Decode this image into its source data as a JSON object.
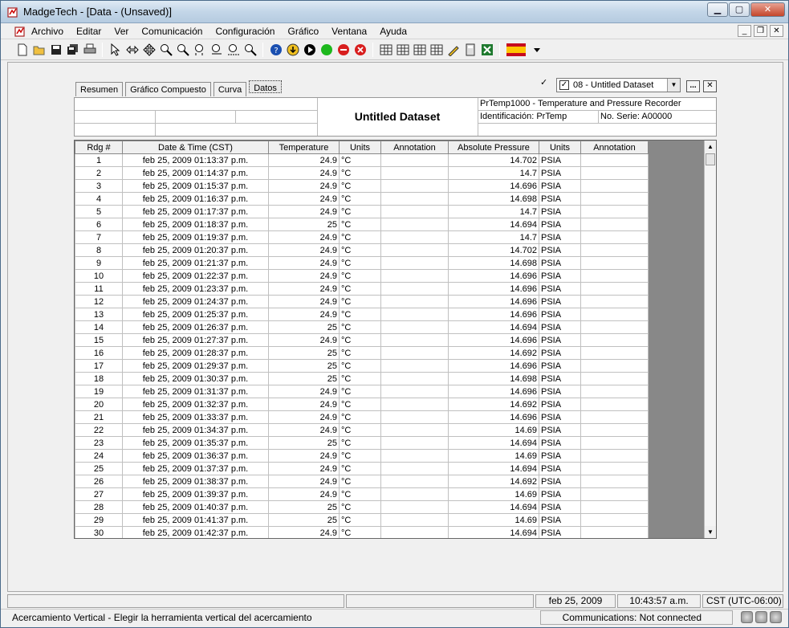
{
  "window": {
    "title": "MadgeTech - [Data - (Unsaved)]"
  },
  "menu": [
    "Archivo",
    "Editar",
    "Ver",
    "Comunicación",
    "Configuración",
    "Gráfico",
    "Ventana",
    "Ayuda"
  ],
  "tabs": [
    "Resumen",
    "Gráfico Compuesto",
    "Curva",
    "Datos"
  ],
  "dataset_selector": {
    "value": "08 - Untitled Dataset",
    "checked": "✓",
    "more_label": "...",
    "close_label": "✕"
  },
  "header": {
    "dataset_title": "Untitled Dataset",
    "device": "PrTemp1000 - Temperature and Pressure Recorder",
    "identification": "Identificación: PrTemp",
    "serial": "No. Serie: A00000"
  },
  "grid": {
    "columns": [
      "Rdg #",
      "Date & Time (CST)",
      "Temperature",
      "Units",
      "Annotation",
      "Absolute Pressure",
      "Units",
      "Annotation"
    ],
    "rows": [
      [
        "1",
        "feb 25, 2009 01:13:37 p.m.",
        "24.9",
        "°C",
        "",
        "14.702",
        "PSIA",
        ""
      ],
      [
        "2",
        "feb 25, 2009 01:14:37 p.m.",
        "24.9",
        "°C",
        "",
        "14.7",
        "PSIA",
        ""
      ],
      [
        "3",
        "feb 25, 2009 01:15:37 p.m.",
        "24.9",
        "°C",
        "",
        "14.696",
        "PSIA",
        ""
      ],
      [
        "4",
        "feb 25, 2009 01:16:37 p.m.",
        "24.9",
        "°C",
        "",
        "14.698",
        "PSIA",
        ""
      ],
      [
        "5",
        "feb 25, 2009 01:17:37 p.m.",
        "24.9",
        "°C",
        "",
        "14.7",
        "PSIA",
        ""
      ],
      [
        "6",
        "feb 25, 2009 01:18:37 p.m.",
        "25",
        "°C",
        "",
        "14.694",
        "PSIA",
        ""
      ],
      [
        "7",
        "feb 25, 2009 01:19:37 p.m.",
        "24.9",
        "°C",
        "",
        "14.7",
        "PSIA",
        ""
      ],
      [
        "8",
        "feb 25, 2009 01:20:37 p.m.",
        "24.9",
        "°C",
        "",
        "14.702",
        "PSIA",
        ""
      ],
      [
        "9",
        "feb 25, 2009 01:21:37 p.m.",
        "24.9",
        "°C",
        "",
        "14.698",
        "PSIA",
        ""
      ],
      [
        "10",
        "feb 25, 2009 01:22:37 p.m.",
        "24.9",
        "°C",
        "",
        "14.696",
        "PSIA",
        ""
      ],
      [
        "11",
        "feb 25, 2009 01:23:37 p.m.",
        "24.9",
        "°C",
        "",
        "14.696",
        "PSIA",
        ""
      ],
      [
        "12",
        "feb 25, 2009 01:24:37 p.m.",
        "24.9",
        "°C",
        "",
        "14.696",
        "PSIA",
        ""
      ],
      [
        "13",
        "feb 25, 2009 01:25:37 p.m.",
        "24.9",
        "°C",
        "",
        "14.696",
        "PSIA",
        ""
      ],
      [
        "14",
        "feb 25, 2009 01:26:37 p.m.",
        "25",
        "°C",
        "",
        "14.694",
        "PSIA",
        ""
      ],
      [
        "15",
        "feb 25, 2009 01:27:37 p.m.",
        "24.9",
        "°C",
        "",
        "14.696",
        "PSIA",
        ""
      ],
      [
        "16",
        "feb 25, 2009 01:28:37 p.m.",
        "25",
        "°C",
        "",
        "14.692",
        "PSIA",
        ""
      ],
      [
        "17",
        "feb 25, 2009 01:29:37 p.m.",
        "25",
        "°C",
        "",
        "14.696",
        "PSIA",
        ""
      ],
      [
        "18",
        "feb 25, 2009 01:30:37 p.m.",
        "25",
        "°C",
        "",
        "14.698",
        "PSIA",
        ""
      ],
      [
        "19",
        "feb 25, 2009 01:31:37 p.m.",
        "24.9",
        "°C",
        "",
        "14.696",
        "PSIA",
        ""
      ],
      [
        "20",
        "feb 25, 2009 01:32:37 p.m.",
        "24.9",
        "°C",
        "",
        "14.692",
        "PSIA",
        ""
      ],
      [
        "21",
        "feb 25, 2009 01:33:37 p.m.",
        "24.9",
        "°C",
        "",
        "14.696",
        "PSIA",
        ""
      ],
      [
        "22",
        "feb 25, 2009 01:34:37 p.m.",
        "24.9",
        "°C",
        "",
        "14.69",
        "PSIA",
        ""
      ],
      [
        "23",
        "feb 25, 2009 01:35:37 p.m.",
        "25",
        "°C",
        "",
        "14.694",
        "PSIA",
        ""
      ],
      [
        "24",
        "feb 25, 2009 01:36:37 p.m.",
        "24.9",
        "°C",
        "",
        "14.69",
        "PSIA",
        ""
      ],
      [
        "25",
        "feb 25, 2009 01:37:37 p.m.",
        "24.9",
        "°C",
        "",
        "14.694",
        "PSIA",
        ""
      ],
      [
        "26",
        "feb 25, 2009 01:38:37 p.m.",
        "24.9",
        "°C",
        "",
        "14.692",
        "PSIA",
        ""
      ],
      [
        "27",
        "feb 25, 2009 01:39:37 p.m.",
        "24.9",
        "°C",
        "",
        "14.69",
        "PSIA",
        ""
      ],
      [
        "28",
        "feb 25, 2009 01:40:37 p.m.",
        "25",
        "°C",
        "",
        "14.694",
        "PSIA",
        ""
      ],
      [
        "29",
        "feb 25, 2009 01:41:37 p.m.",
        "25",
        "°C",
        "",
        "14.69",
        "PSIA",
        ""
      ],
      [
        "30",
        "feb 25, 2009 01:42:37 p.m.",
        "24.9",
        "°C",
        "",
        "14.694",
        "PSIA",
        ""
      ]
    ]
  },
  "status": {
    "date": "feb 25, 2009",
    "time": "10:43:57 a.m.",
    "timezone": "CST (UTC-06:00)",
    "message": "Acercamiento Vertical - Elegir la herramienta vertical del acercamiento",
    "communications": "Communications: Not connected"
  },
  "colors": {
    "grid_filler": "#888888",
    "titlebar": "#c3d6e8",
    "close_button": "#c4452a"
  }
}
